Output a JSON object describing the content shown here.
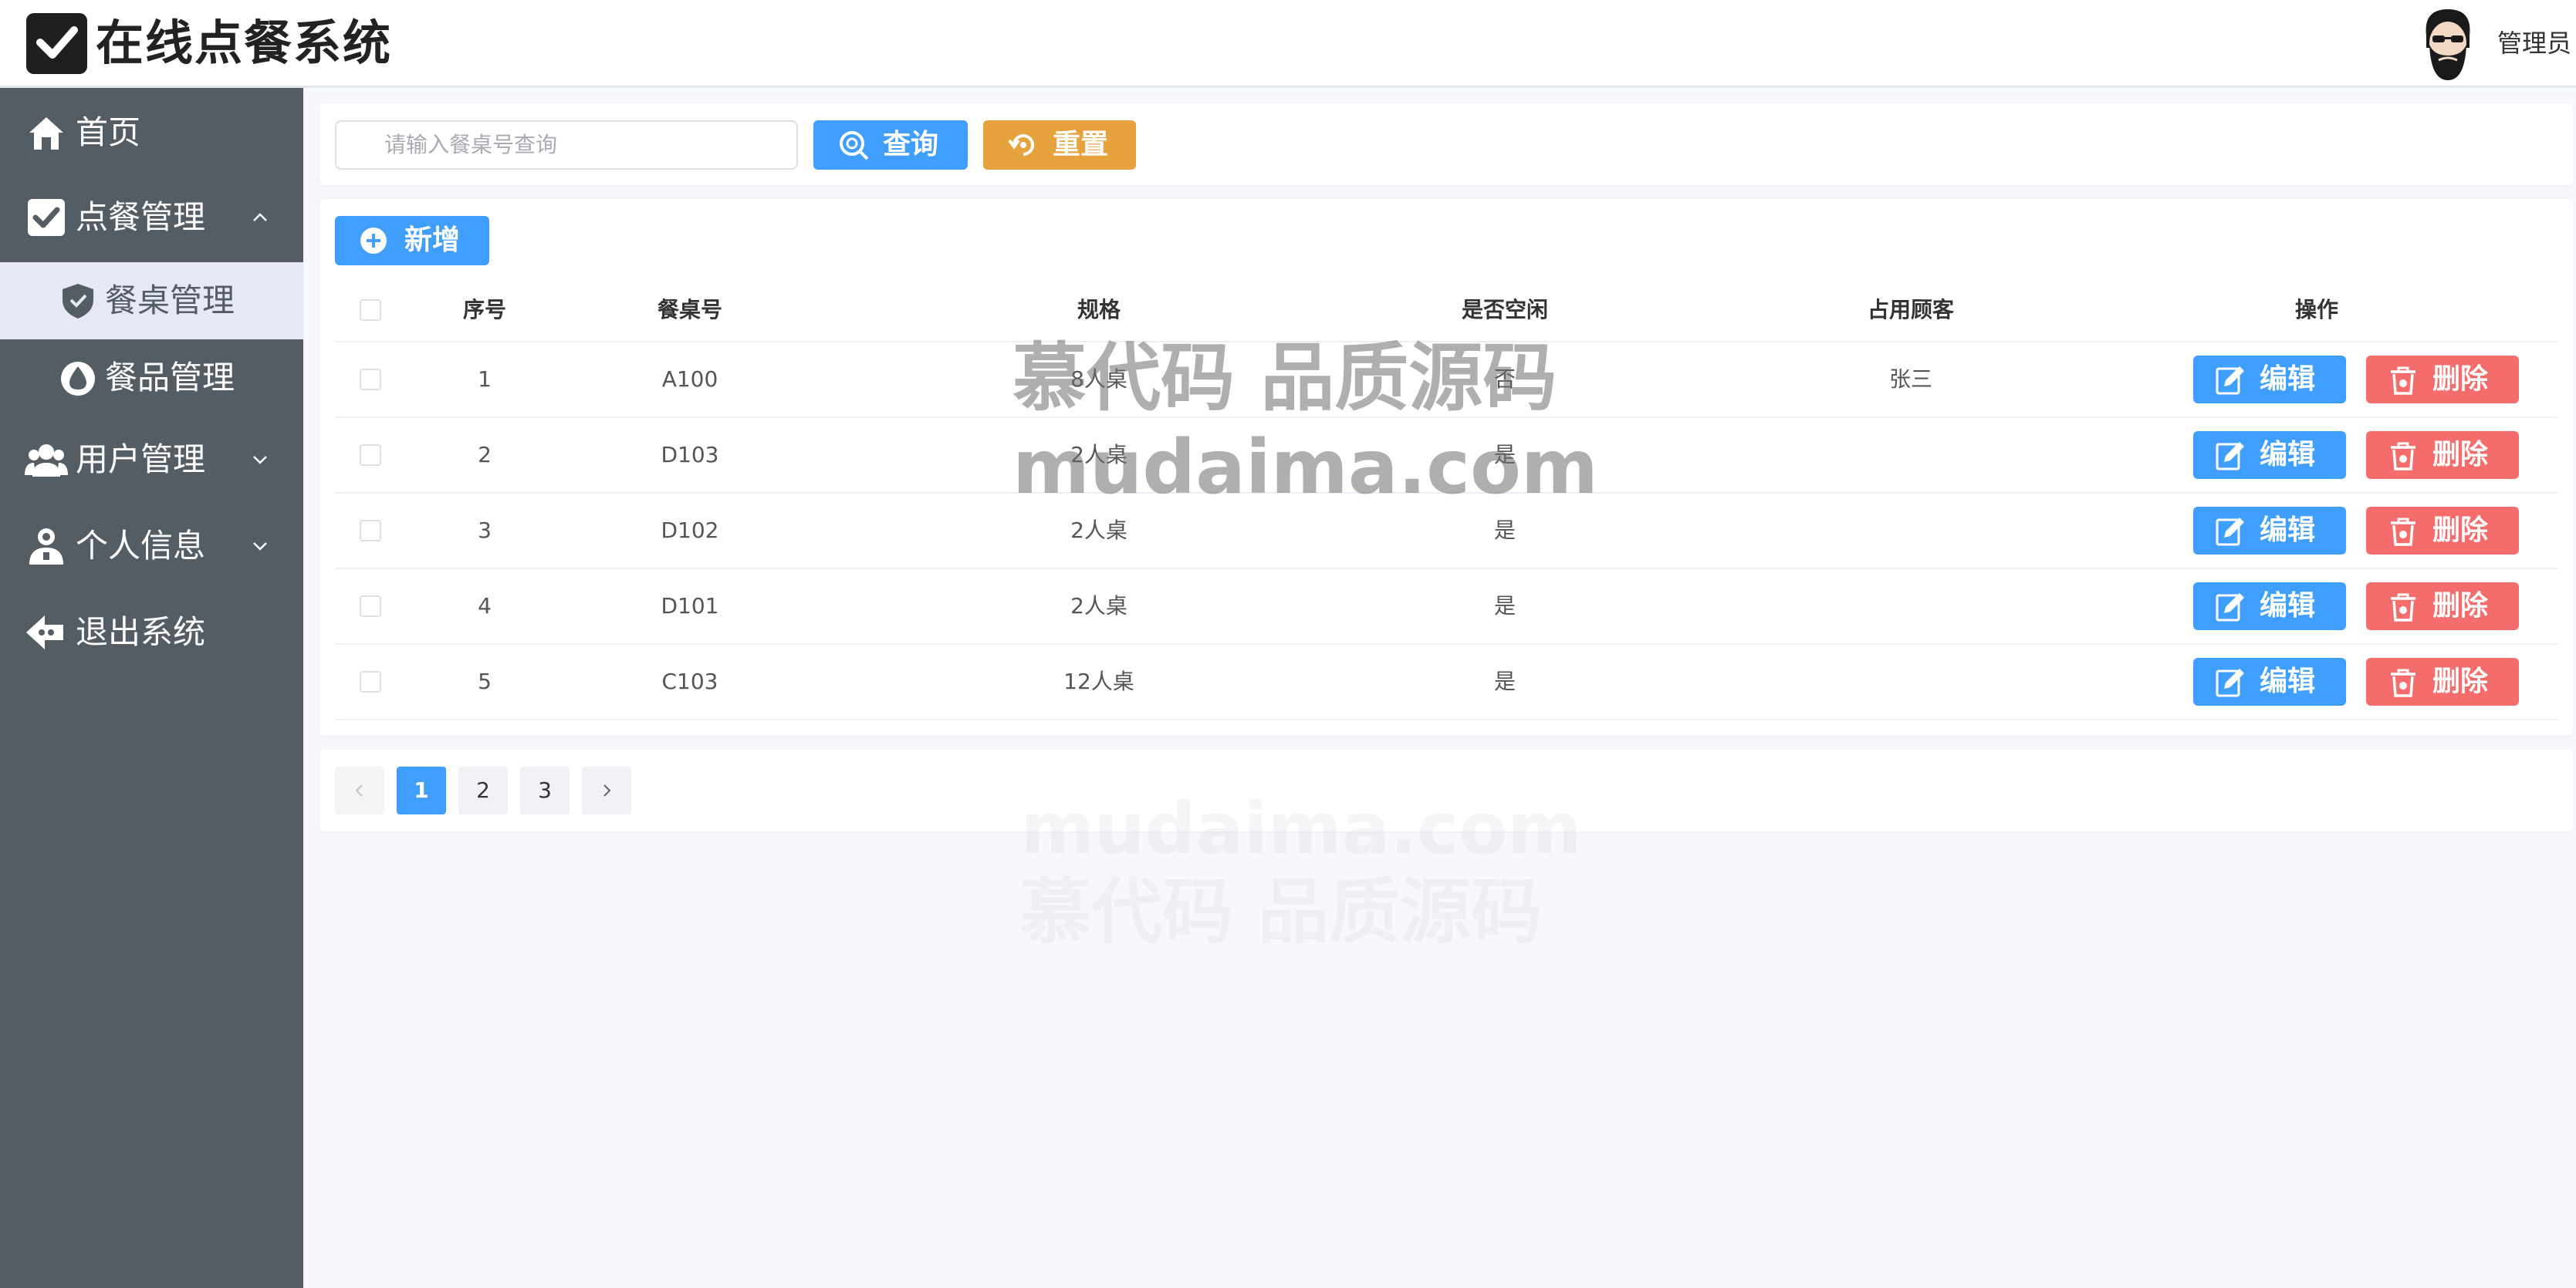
{
  "header": {
    "title": "在线点餐系统",
    "user_name": "管理员"
  },
  "sidebar": {
    "items": [
      {
        "label": "首页",
        "icon": "home-icon"
      },
      {
        "label": "点餐管理",
        "icon": "check-box-icon",
        "expanded": true
      },
      {
        "label": "餐桌管理",
        "icon": "shield-icon",
        "active": true
      },
      {
        "label": "餐品管理",
        "icon": "drop-icon"
      },
      {
        "label": "用户管理",
        "icon": "users-icon"
      },
      {
        "label": "个人信息",
        "icon": "user-icon"
      },
      {
        "label": "退出系统",
        "icon": "logout-icon"
      }
    ]
  },
  "search": {
    "placeholder": "请输入餐桌号查询",
    "query_label": "查询",
    "reset_label": "重置"
  },
  "toolbar": {
    "add_label": "新增"
  },
  "table": {
    "columns": [
      "序号",
      "餐桌号",
      "规格",
      "是否空闲",
      "占用顾客",
      "操作"
    ],
    "rows": [
      {
        "index": "1",
        "table_no": "A100",
        "spec": "8人桌",
        "idle": "否",
        "customer": "张三"
      },
      {
        "index": "2",
        "table_no": "D103",
        "spec": "2人桌",
        "idle": "是",
        "customer": ""
      },
      {
        "index": "3",
        "table_no": "D102",
        "spec": "2人桌",
        "idle": "是",
        "customer": ""
      },
      {
        "index": "4",
        "table_no": "D101",
        "spec": "2人桌",
        "idle": "是",
        "customer": ""
      },
      {
        "index": "5",
        "table_no": "C103",
        "spec": "12人桌",
        "idle": "是",
        "customer": ""
      }
    ],
    "edit_label": "编辑",
    "delete_label": "删除"
  },
  "pagination": {
    "pages": [
      "1",
      "2",
      "3"
    ],
    "current": "1"
  },
  "watermark": {
    "line1": "慕代码 品质源码",
    "line2": "mudaima.com"
  },
  "colors": {
    "primary": "#409eff",
    "warning": "#e6a23c",
    "danger": "#f56c6c",
    "sidebar_bg": "#545c64",
    "active_sub_bg": "#e6e8f6"
  }
}
